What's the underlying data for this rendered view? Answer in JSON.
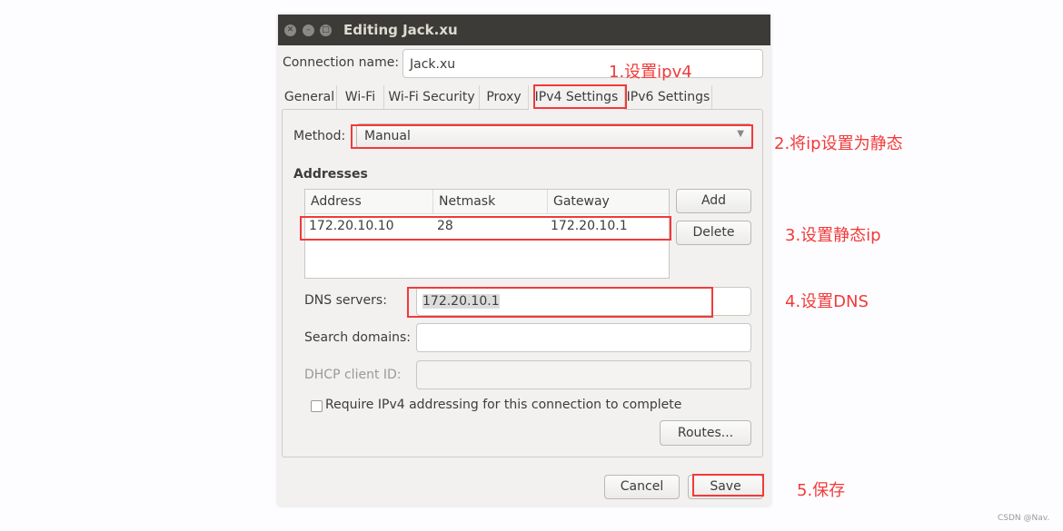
{
  "window": {
    "title": "Editing Jack.xu"
  },
  "connection": {
    "label": "Connection name:",
    "value": "Jack.xu"
  },
  "tabs": [
    "General",
    "Wi-Fi",
    "Wi-Fi Security",
    "Proxy",
    "IPv4 Settings",
    "IPv6 Settings"
  ],
  "active_tab": "IPv4 Settings",
  "method": {
    "label": "Method:",
    "value": "Manual"
  },
  "addresses": {
    "heading": "Addresses",
    "columns": [
      "Address",
      "Netmask",
      "Gateway"
    ],
    "rows": [
      [
        "172.20.10.10",
        "28",
        "172.20.10.1"
      ]
    ],
    "add": "Add",
    "delete": "Delete"
  },
  "dns": {
    "label": "DNS servers:",
    "value": "172.20.10.1"
  },
  "search": {
    "label": "Search domains:",
    "value": ""
  },
  "dhcp": {
    "label": "DHCP client ID:",
    "value": ""
  },
  "require": {
    "label": "Require IPv4 addressing for this connection to complete",
    "checked": false
  },
  "routes": "Routes...",
  "cancel": "Cancel",
  "save": "Save",
  "annotations": [
    "1.设置ipv4",
    "2.将ip设置为静态",
    "3.设置静态ip",
    "4.设置DNS",
    "5.保存"
  ],
  "watermark": "CSDN @Nav.",
  "colors": {
    "annotation": "#f23a3a",
    "titlebar": "#3c3b37"
  }
}
